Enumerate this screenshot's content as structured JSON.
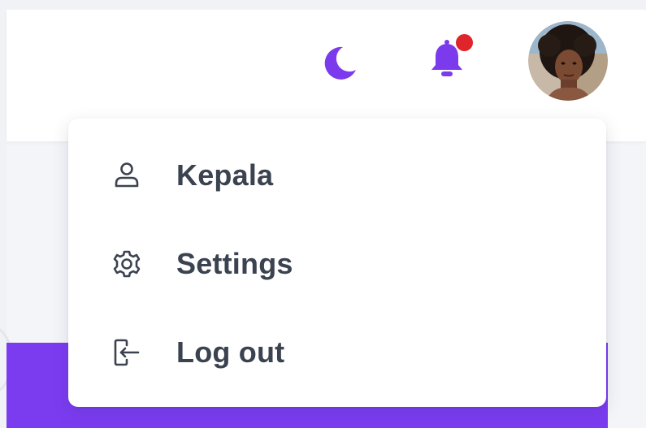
{
  "header": {
    "theme_toggle_icon": "moon-icon",
    "notification_icon": "bell-icon",
    "notification_badge_color": "#e0242b",
    "accent_color": "#7c3aed",
    "avatar_icon": "user-avatar"
  },
  "dropdown": {
    "items": [
      {
        "label": "Kepala",
        "icon": "user-icon"
      },
      {
        "label": "Settings",
        "icon": "gear-icon"
      },
      {
        "label": "Log out",
        "icon": "logout-icon"
      }
    ]
  },
  "colors": {
    "background": "#f1f2f6",
    "header": "#ffffff",
    "purple_band": "#7b3cf0",
    "menu_text": "#3b4250"
  }
}
